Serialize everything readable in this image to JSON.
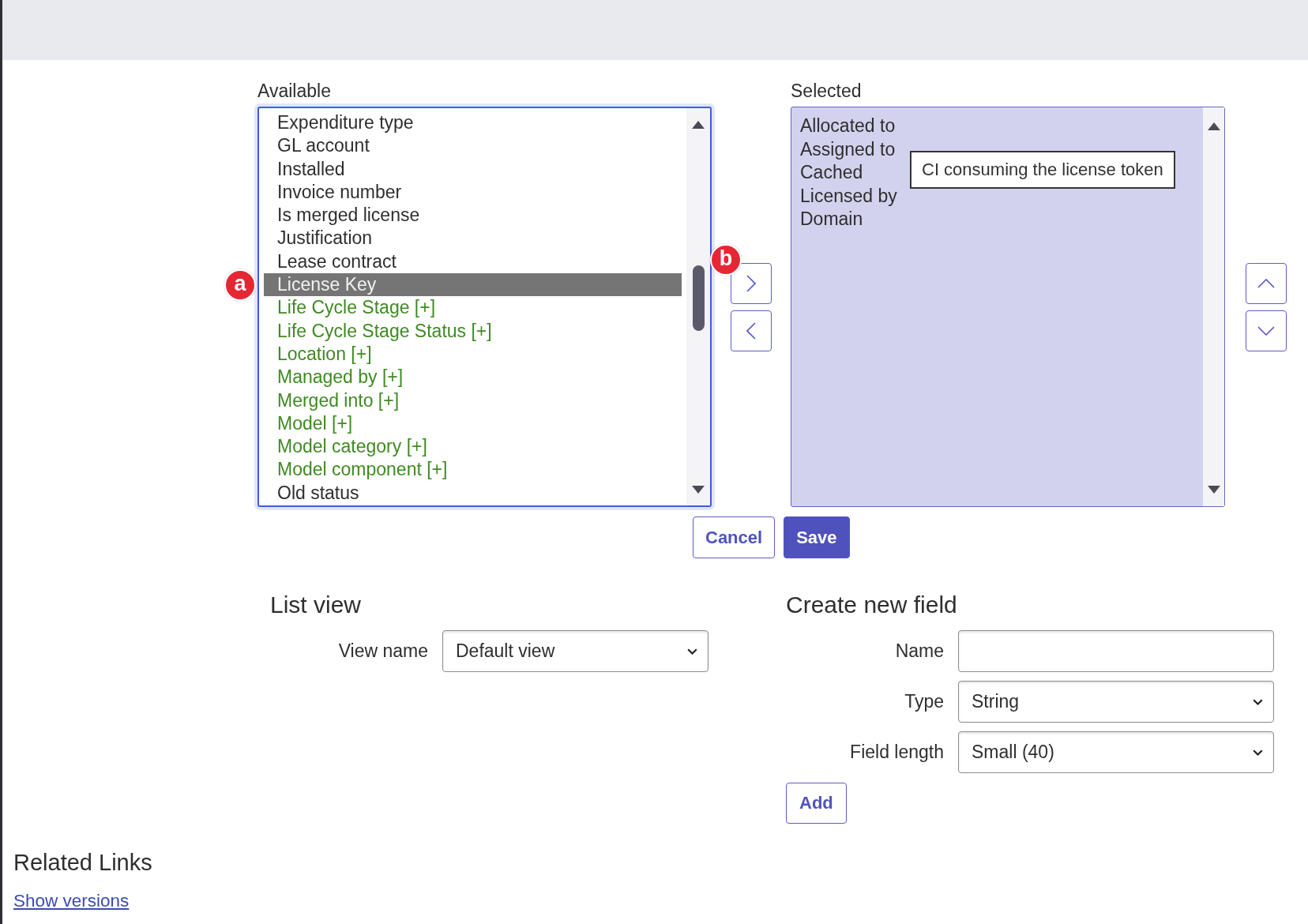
{
  "available": {
    "label": "Available",
    "items": [
      {
        "label": "Expenditure type",
        "kind": "field",
        "selected": false
      },
      {
        "label": "GL account",
        "kind": "field",
        "selected": false
      },
      {
        "label": "Installed",
        "kind": "field",
        "selected": false
      },
      {
        "label": "Invoice number",
        "kind": "field",
        "selected": false
      },
      {
        "label": "Is merged license",
        "kind": "field",
        "selected": false
      },
      {
        "label": "Justification",
        "kind": "field",
        "selected": false
      },
      {
        "label": "Lease contract",
        "kind": "field",
        "selected": false
      },
      {
        "label": "License Key",
        "kind": "field",
        "selected": true,
        "marker": "a"
      },
      {
        "label": "Life Cycle Stage [+]",
        "kind": "reference",
        "selected": false
      },
      {
        "label": "Life Cycle Stage Status [+]",
        "kind": "reference",
        "selected": false
      },
      {
        "label": "Location [+]",
        "kind": "reference",
        "selected": false
      },
      {
        "label": "Managed by [+]",
        "kind": "reference",
        "selected": false
      },
      {
        "label": "Merged into [+]",
        "kind": "reference",
        "selected": false
      },
      {
        "label": "Model [+]",
        "kind": "reference",
        "selected": false
      },
      {
        "label": "Model category [+]",
        "kind": "reference",
        "selected": false
      },
      {
        "label": "Model component [+]",
        "kind": "reference",
        "selected": false
      },
      {
        "label": "Old status",
        "kind": "field",
        "selected": false
      }
    ]
  },
  "add_button": {
    "marker": "b"
  },
  "selected": {
    "label": "Selected",
    "items": [
      {
        "label": "Allocated to",
        "selected": false
      },
      {
        "label": "Assigned to",
        "selected": false
      },
      {
        "label": "Cached",
        "selected": false
      },
      {
        "label": "Licensed by",
        "selected": false
      },
      {
        "label": "Domain",
        "selected": false
      }
    ],
    "tooltip": "CI consuming the license token"
  },
  "actions": [
    {
      "label": "Cancel",
      "kind": "secondary"
    },
    {
      "label": "Save",
      "kind": "primary"
    }
  ],
  "list_view": {
    "title": "List view",
    "fields": [
      {
        "label": "View name",
        "kind": "select",
        "value": "Default view"
      }
    ]
  },
  "create_new_field": {
    "title": "Create new field",
    "fields": [
      {
        "label": "Name",
        "kind": "text"
      },
      {
        "label": "Type",
        "kind": "select",
        "value": "String"
      },
      {
        "label": "Field length",
        "kind": "select",
        "value": "Small (40)"
      }
    ],
    "submit": "Add"
  },
  "related_links": {
    "title": "Related Links",
    "links": [
      "Show versions"
    ]
  }
}
